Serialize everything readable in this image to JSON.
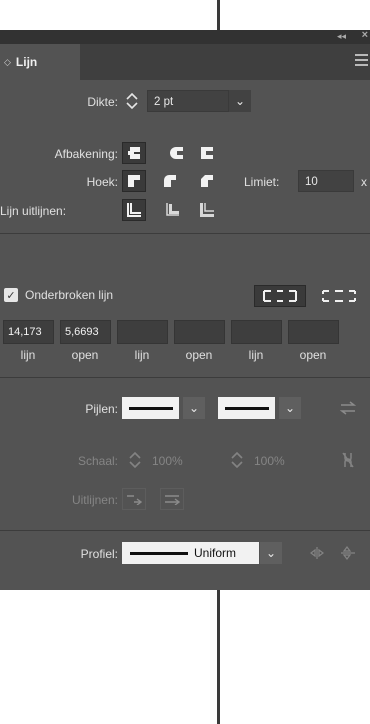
{
  "panel": {
    "collapse_icon": "double-chevron-left-icon",
    "close_icon": "close-icon",
    "tab_label": "Lijn",
    "tab_arrow": "◇",
    "menu_icon": "hamburger-icon"
  },
  "stroke": {
    "weight_label": "Dikte:",
    "weight_value": "2 pt",
    "cap_label": "Afbakening:",
    "corner_label": "Hoek:",
    "limit_label": "Limiet:",
    "limit_value": "10",
    "limit_unit": "x",
    "align_label": "Lijn uitlijnen:"
  },
  "dashed": {
    "checkbox_label": "Onderbroken lijn",
    "checked": true,
    "fields": [
      {
        "value": "14,173",
        "label": "lijn"
      },
      {
        "value": "5,6693",
        "label": "open"
      },
      {
        "value": "",
        "label": "lijn"
      },
      {
        "value": "",
        "label": "open"
      },
      {
        "value": "",
        "label": "lijn"
      },
      {
        "value": "",
        "label": "open"
      }
    ]
  },
  "arrows": {
    "label": "Pijlen:",
    "scale_label": "Schaal:",
    "scale_start": "100%",
    "scale_end": "100%",
    "align_label": "Uitlijnen:"
  },
  "profile": {
    "label": "Profiel:",
    "value": "Uniform"
  },
  "colors": {
    "panel_bg": "#535353",
    "tab_bar_bg": "#3f3f3f",
    "title_bar_bg": "#323232",
    "field_bg": "#424242"
  }
}
